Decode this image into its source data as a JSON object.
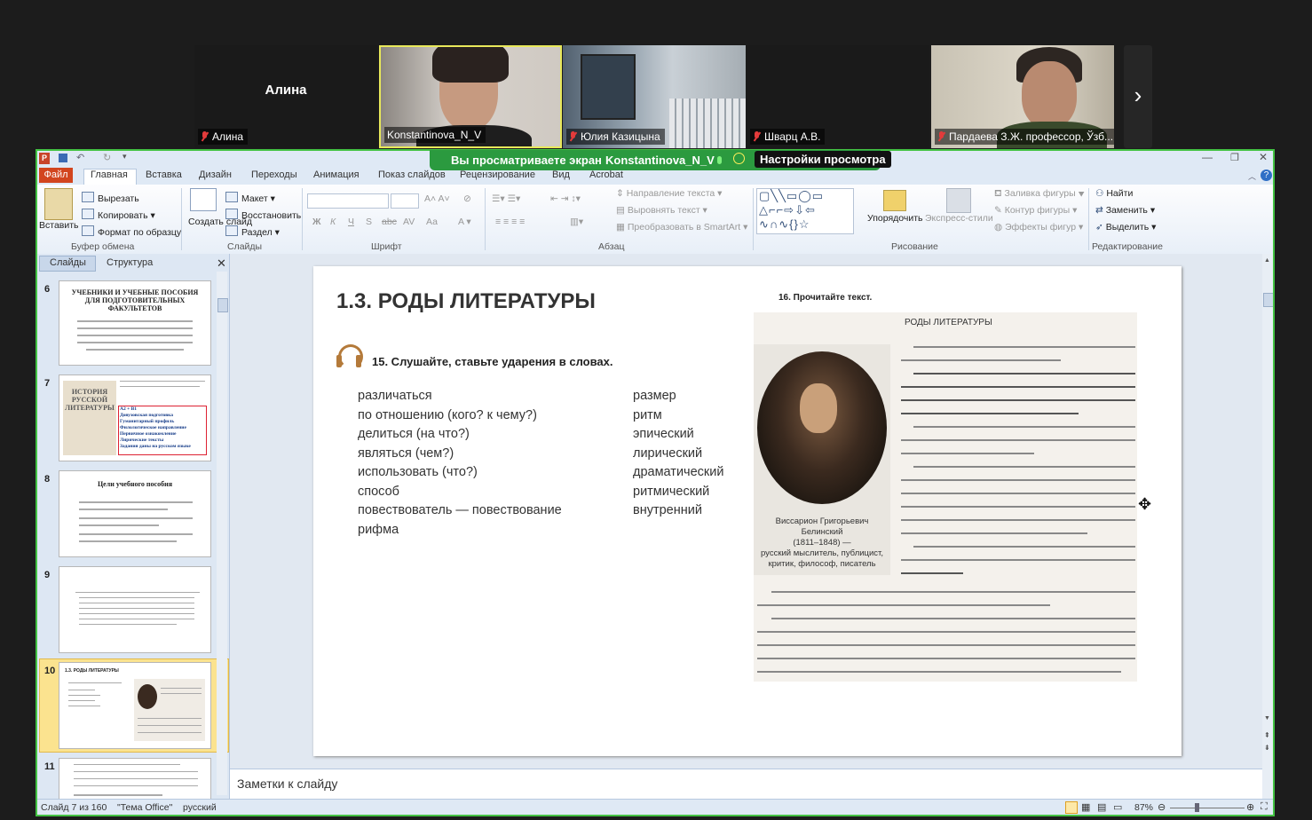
{
  "meeting": {
    "participants": [
      {
        "name": "Алина",
        "label": "Алина",
        "muted": true,
        "video": false
      },
      {
        "name": "Konstantinova_N_V",
        "muted": false,
        "video": true
      },
      {
        "name": "Юлия Казицына",
        "muted": true,
        "video": true
      },
      {
        "name": "Шварц А.В.",
        "muted": true,
        "video": false
      },
      {
        "name": "Пардаева З.Ж. профессор, Ўзб...",
        "muted": true,
        "video": true
      }
    ],
    "next_icon": "chevron-right-icon",
    "banner": {
      "text": "Вы просматриваете экран",
      "presenter": "Konstantinova_N_V",
      "settings_label": "Настройки просмотра"
    },
    "frame_color": "#43c243"
  },
  "ppt": {
    "tabs": [
      "Файл",
      "Главная",
      "Вставка",
      "Дизайн",
      "Переходы",
      "Анимация",
      "Показ слайдов",
      "Рецензирование",
      "Вид",
      "Acrobat"
    ],
    "ribbon": {
      "clipboard": {
        "paste": "Вставить",
        "cut": "Вырезать",
        "copy": "Копировать",
        "format": "Формат по образцу",
        "group": "Буфер обмена"
      },
      "slides": {
        "new": "Создать слайд",
        "layout": "Макет",
        "restore": "Восстановить",
        "section": "Раздел",
        "group": "Слайды"
      },
      "font": {
        "group": "Шрифт",
        "bold": "Ж",
        "italic": "К",
        "underline": "Ч",
        "strike": "S",
        "abc": "abc",
        "aa": "Аа"
      },
      "paragraph": {
        "direction": "Направление текста",
        "align": "Выровнять текст",
        "smartart": "Преобразовать в SmartArt",
        "group": "Абзац"
      },
      "drawing": {
        "arrange": "Упорядочить",
        "styles": "Экспресс-стили",
        "fill": "Заливка фигуры",
        "outline": "Контур фигуры",
        "effects": "Эффекты фигур",
        "group": "Рисование"
      },
      "editing": {
        "find": "Найти",
        "replace": "Заменить",
        "select": "Выделить",
        "group": "Редактирование"
      }
    },
    "pane_tabs": [
      "Слайды",
      "Структура"
    ],
    "thumbnails": [
      {
        "num": "6",
        "title": "УЧЕБНИКИ И УЧЕБНЫЕ ПОСОБИЯ ДЛЯ ПОДГОТОВИТЕЛЬНЫХ ФАКУЛЬТЕТОВ"
      },
      {
        "num": "7",
        "title": "ИСТОРИЯ РУССКОЙ ЛИТЕРАТУРЫ",
        "lines": [
          "А2 + В1",
          "Довузовская подготовка",
          "Гуманитарный профиль",
          "Филологическое направление",
          "Первичное ознакомление",
          "Лирические тексты",
          "Задания даны на русском языке"
        ]
      },
      {
        "num": "8",
        "title": "Цели учебного пособия"
      },
      {
        "num": "9",
        "title": ""
      },
      {
        "num": "10",
        "title": "1.3. РОДЫ ЛИТЕРАТУРЫ",
        "selected": true
      },
      {
        "num": "11",
        "title": ""
      }
    ],
    "notes_placeholder": "Заметки к слайду",
    "status": {
      "slide": "Слайд 7 из 160",
      "theme": "\"Тема Office\"",
      "lang": "русский",
      "zoom": "87%"
    }
  },
  "slide": {
    "title": "1.3. РОДЫ ЛИТЕРАТУРЫ",
    "exercise15": "15. Слушайте, ставьте ударения в словах.",
    "left_words": [
      "различаться",
      "по отношению (кого? к чему?)",
      "делиться (на что?)",
      "являться (чем?)",
      "использовать (что?)",
      "способ",
      "повествователь — повествование",
      "рифма"
    ],
    "right_words": [
      "размер",
      "ритм",
      "эпический",
      "лирический",
      "драматический",
      "ритмический",
      "внутренний"
    ],
    "exercise16": "16. Прочитайте текст.",
    "text_heading": "РОДЫ ЛИТЕРАТУРЫ",
    "caption": [
      "Виссарион Григорьевич",
      "Белинский",
      "(1811–1848) —",
      "русский мыслитель, публицист,",
      "критик, философ, писатель"
    ]
  }
}
